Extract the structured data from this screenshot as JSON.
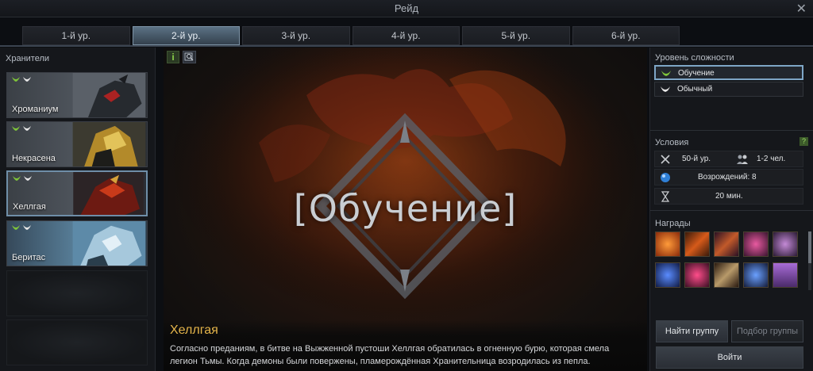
{
  "window": {
    "title": "Рейд",
    "close_icon": "close-icon"
  },
  "tabs": [
    {
      "label": "1-й ур.",
      "active": false
    },
    {
      "label": "2-й ур.",
      "active": true
    },
    {
      "label": "3-й ур.",
      "active": false
    },
    {
      "label": "4-й ур.",
      "active": false
    },
    {
      "label": "5-й ур.",
      "active": false
    },
    {
      "label": "6-й ур.",
      "active": false
    }
  ],
  "guardians": {
    "heading": "Хранители",
    "items": [
      {
        "name": "Хроманиум",
        "selected": false
      },
      {
        "name": "Некрасена",
        "selected": false
      },
      {
        "name": "Хеллгая",
        "selected": true
      },
      {
        "name": "Беритас",
        "selected": false
      }
    ]
  },
  "center": {
    "stage_label": "[Обучение]",
    "info_label": "i",
    "boss_name": "Хеллгая",
    "boss_description": "Согласно преданиям, в битве на Выжженной пустоши Хеллгая обратилась в огненную бурю, которая смела легион Тьмы. Когда демоны были повержены, пламерождённая Хранительница возродилась из пепла."
  },
  "difficulty": {
    "title": "Уровень сложности",
    "options": [
      {
        "label": "Обучение",
        "selected": true
      },
      {
        "label": "Обычный",
        "selected": false
      }
    ]
  },
  "conditions": {
    "title": "Условия",
    "help": "?",
    "level": "50-й ур.",
    "party": "1-2 чел.",
    "revives": "Возрождений: 8",
    "time": "20 мин."
  },
  "rewards": {
    "title": "Награды",
    "items": [
      "orb-icon",
      "feather-icon",
      "feather-icon",
      "amulet-icon",
      "amulet-icon",
      "ring-icon",
      "amulet-icon",
      "staff-icon",
      "ring-icon",
      "chest-icon"
    ]
  },
  "buttons": {
    "find_group": "Найти группу",
    "match_group": "Подбор группы",
    "enter": "Войти"
  },
  "colors": {
    "accent": "#7ea6c6",
    "boss_name": "#e5b54a",
    "tab_active": "#5b7184"
  }
}
